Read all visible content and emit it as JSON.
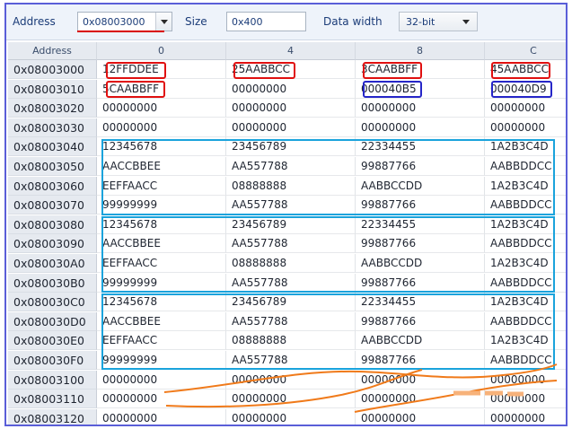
{
  "toolbar": {
    "address_label": "Address",
    "address_value": "0x08003000",
    "size_label": "Size",
    "size_value": "0x400",
    "data_width_label": "Data width",
    "data_width_value": "32-bit"
  },
  "grid": {
    "header": {
      "address": "Address",
      "columns": [
        "0",
        "4",
        "8",
        "C"
      ]
    },
    "rows": [
      {
        "address": "0x08003000",
        "values": [
          "12FFDDEE",
          "25AABBCC",
          "3CAABBFF",
          "45AABBCC"
        ]
      },
      {
        "address": "0x08003010",
        "values": [
          "5CAABBFF",
          "00000000",
          "000040B5",
          "000040D9"
        ]
      },
      {
        "address": "0x08003020",
        "values": [
          "00000000",
          "00000000",
          "00000000",
          "00000000"
        ]
      },
      {
        "address": "0x08003030",
        "values": [
          "00000000",
          "00000000",
          "00000000",
          "00000000"
        ]
      },
      {
        "address": "0x08003040",
        "values": [
          "12345678",
          "23456789",
          "22334455",
          "1A2B3C4D"
        ]
      },
      {
        "address": "0x08003050",
        "values": [
          "AACCBBEE",
          "AA557788",
          "99887766",
          "AABBDDCC"
        ]
      },
      {
        "address": "0x08003060",
        "values": [
          "EEFFAACC",
          "08888888",
          "AABBCCDD",
          "1A2B3C4D"
        ]
      },
      {
        "address": "0x08003070",
        "values": [
          "99999999",
          "AA557788",
          "99887766",
          "AABBDDCC"
        ]
      },
      {
        "address": "0x08003080",
        "values": [
          "12345678",
          "23456789",
          "22334455",
          "1A2B3C4D"
        ]
      },
      {
        "address": "0x08003090",
        "values": [
          "AACCBBEE",
          "AA557788",
          "99887766",
          "AABBDDCC"
        ]
      },
      {
        "address": "0x080030A0",
        "values": [
          "EEFFAACC",
          "08888888",
          "AABBCCDD",
          "1A2B3C4D"
        ]
      },
      {
        "address": "0x080030B0",
        "values": [
          "99999999",
          "AA557788",
          "99887766",
          "AABBDDCC"
        ]
      },
      {
        "address": "0x080030C0",
        "values": [
          "12345678",
          "23456789",
          "22334455",
          "1A2B3C4D"
        ]
      },
      {
        "address": "0x080030D0",
        "values": [
          "AACCBBEE",
          "AA557788",
          "99887766",
          "AABBDDCC"
        ]
      },
      {
        "address": "0x080030E0",
        "values": [
          "EEFFAACC",
          "08888888",
          "AABBCCDD",
          "1A2B3C4D"
        ]
      },
      {
        "address": "0x080030F0",
        "values": [
          "99999999",
          "AA557788",
          "99887766",
          "AABBDDCC"
        ]
      },
      {
        "address": "0x08003100",
        "values": [
          "00000000",
          "00000000",
          "00000000",
          "00000000"
        ]
      },
      {
        "address": "0x08003110",
        "values": [
          "00000000",
          "00000000",
          "00000000",
          "00000000"
        ]
      },
      {
        "address": "0x08003120",
        "values": [
          "00000000",
          "00000000",
          "00000000",
          "00000000"
        ]
      }
    ]
  },
  "colors": {
    "frame_border": "#5a5ed8",
    "header_bg": "#e6eaf0",
    "annotation_red": "#e01010",
    "annotation_navy": "#2626c8",
    "annotation_cyan": "#1aa3dc",
    "scribble_orange": "#f07a1a"
  }
}
